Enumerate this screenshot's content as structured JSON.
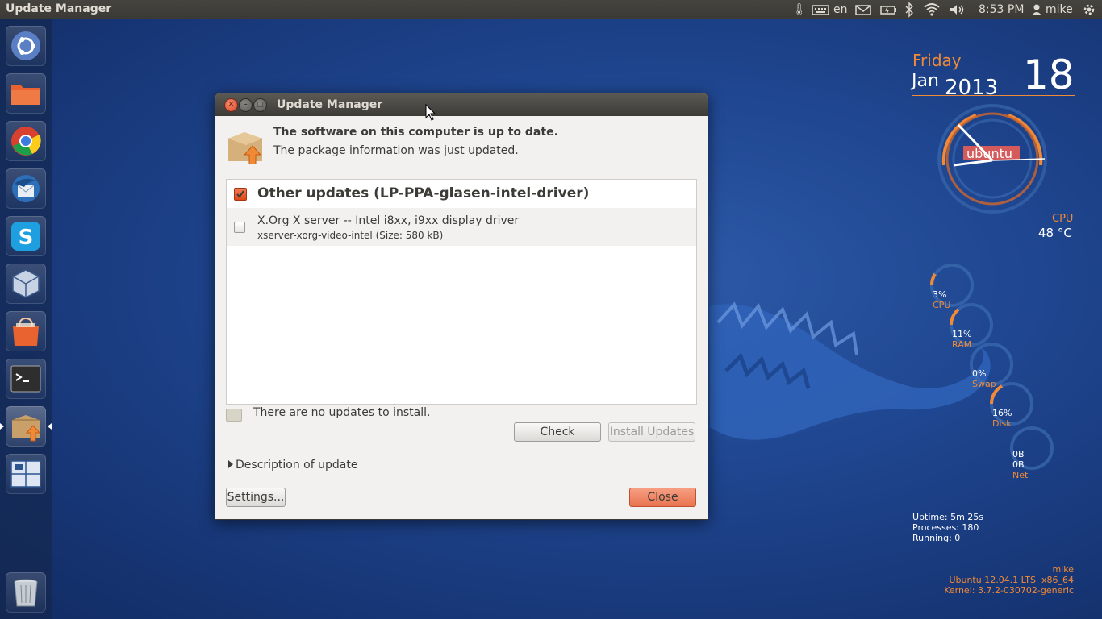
{
  "top_panel": {
    "app_title": "Update Manager",
    "keyboard_layout": "en",
    "clock": "8:53 PM",
    "user": "mike"
  },
  "launcher": {
    "items": [
      "Dash Home",
      "Files",
      "Google Chrome",
      "Thunderbird",
      "Skype",
      "VirtualBox",
      "Ubuntu Software Center",
      "Terminal",
      "Update Manager",
      "Workspace Switcher",
      "Trash"
    ]
  },
  "window": {
    "title": "Update Manager",
    "status_main": "The software on this computer is up to date.",
    "status_sub": "The package information was just updated.",
    "group": {
      "label": "Other updates (LP-PPA-glasen-intel-driver)",
      "checked": true
    },
    "items": [
      {
        "title": "X.Org X server -- Intel i8xx, i9xx display driver",
        "subtitle": "xserver-xorg-video-intel (Size: 580 kB)",
        "checked": false
      }
    ],
    "no_updates_text": "There are no updates to install.",
    "check_label": "Check",
    "install_label": "Install Updates",
    "description_label": "Description of update",
    "settings_label": "Settings...",
    "close_label": "Close"
  },
  "conky": {
    "day": "Friday",
    "month": "Jan",
    "year": "2013",
    "daynum": "18",
    "clock_brand": "ubuntu",
    "cpu_label": "CPU",
    "cpu_temp": "48 °C",
    "rings": [
      {
        "value": "3%",
        "label": "CPU",
        "fraction": 0.03
      },
      {
        "value": "11%",
        "label": "RAM",
        "fraction": 0.11
      },
      {
        "value": "0%",
        "label": "Swap",
        "fraction": 0.0
      },
      {
        "value": "16%",
        "label": "Disk",
        "fraction": 0.16
      },
      {
        "value": "0B",
        "value2": "0B",
        "label": "Net",
        "fraction": 0.0
      }
    ],
    "uptime": "Uptime: 5m 25s",
    "processes": "Processes: 180",
    "running": "Running: 0",
    "user": "mike",
    "os": "Ubuntu 12.04.1 LTS  x86_64",
    "kernel": "Kernel: 3.7.2-030702-generic"
  },
  "colors": {
    "accent": "#f08a36",
    "ubuntu_orange": "#dd4814",
    "panel": "#3c3b37"
  }
}
